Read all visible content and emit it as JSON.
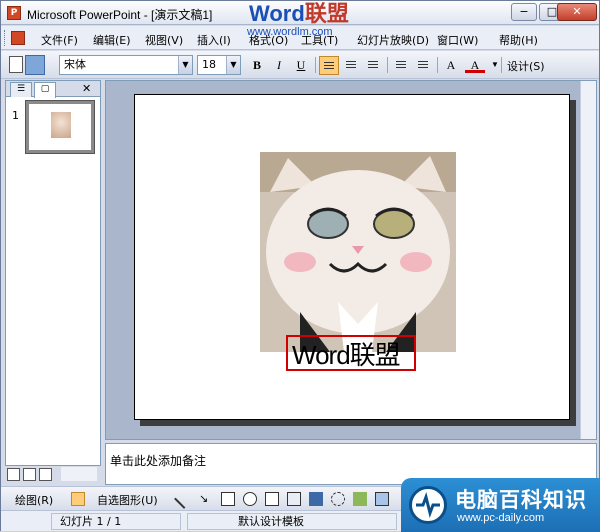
{
  "window": {
    "title": "Microsoft PowerPoint - [演示文稿1]",
    "app_icon": "P"
  },
  "watermark": {
    "brand_word": "Word",
    "brand_cn": "联盟",
    "url": "www.wordlm.com"
  },
  "window_controls": {
    "minimize": "−",
    "maximize": "□",
    "close": "✕"
  },
  "menu": {
    "items": [
      "文件(F)",
      "编辑(E)",
      "视图(V)",
      "插入(I)",
      "格式(O)",
      "工具(T)",
      "幻灯片放映(D)",
      "窗口(W)",
      "帮助(H)"
    ]
  },
  "format_toolbar": {
    "font_name": "宋体",
    "font_size": "18",
    "bold": "B",
    "italic": "I",
    "underline": "U",
    "increase_font": "A",
    "font_color": "A",
    "design": "设计(S)"
  },
  "left_pane": {
    "tab_outline_icon": "outline-icon",
    "tab_slides_icon": "slides-icon",
    "close": "✕",
    "slide_number": "1"
  },
  "slide": {
    "textbox_text": "Word联盟"
  },
  "notes": {
    "placeholder": "单击此处添加备注"
  },
  "drawing_toolbar": {
    "draw_menu": "绘图(R)",
    "autoshapes": "自选图形(U)"
  },
  "status": {
    "slide_position": "幻灯片 1 / 1",
    "design_template": "默认设计模板"
  },
  "site_badge": {
    "title": "电脑百科知识",
    "url": "www.pc-daily.com"
  },
  "colors": {
    "accent_active": "#ffcc7a",
    "highlight_box": "#d00000",
    "badge_blue": "#1d6fb5"
  }
}
